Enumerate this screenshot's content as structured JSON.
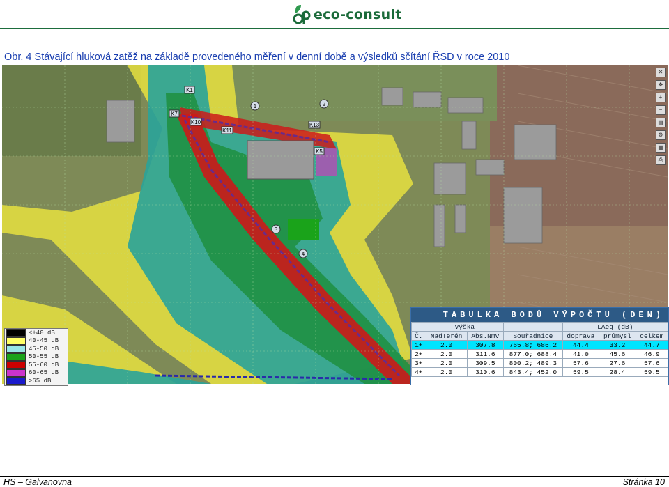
{
  "header": {
    "logo_text": "eco-consult"
  },
  "caption": "Obr. 4 Stávající hluková zatěž na základě provedeného měření v denní době a výsledků sčítání ŘSD v roce 2010",
  "map": {
    "labels": [
      "1",
      "2",
      "3",
      "4",
      "K1",
      "K5",
      "K10",
      "K11",
      "K13",
      "K7"
    ],
    "legend": [
      {
        "label": "<+40 dB",
        "color": "#000000"
      },
      {
        "label": "40-45 dB",
        "color": "#ffff66"
      },
      {
        "label": "45-50 dB",
        "color": "#99e6e6"
      },
      {
        "label": "50-55 dB",
        "color": "#1aa31a"
      },
      {
        "label": "55-60 dB",
        "color": "#cc0000"
      },
      {
        "label": "60-65 dB",
        "color": "#cc33cc"
      },
      {
        "label": ">65 dB",
        "color": "#1a1acc"
      }
    ]
  },
  "table": {
    "title": "TABULKA BODŮ VÝPOČTU (DEN)",
    "group_headers": {
      "vyska": "Výška",
      "laeq": "LAeq (dB)"
    },
    "columns": [
      "Č.",
      "NadTerén",
      "Abs.Nmv",
      "Souřadnice",
      "doprava",
      "průmysl",
      "celkem"
    ],
    "rows": [
      {
        "c": "1+",
        "nad": "2.0",
        "abs": "307.8",
        "sour": "765.8; 686.2",
        "dop": "44.4",
        "pru": "33.2",
        "cel": "44.7"
      },
      {
        "c": "2+",
        "nad": "2.0",
        "abs": "311.6",
        "sour": "877.0; 688.4",
        "dop": "41.0",
        "pru": "45.6",
        "cel": "46.9"
      },
      {
        "c": "3+",
        "nad": "2.0",
        "abs": "309.5",
        "sour": "800.2; 489.3",
        "dop": "57.6",
        "pru": "27.6",
        "cel": "57.6"
      },
      {
        "c": "4+",
        "nad": "2.0",
        "abs": "310.6",
        "sour": "843.4; 452.0",
        "dop": "59.5",
        "pru": "28.4",
        "cel": "59.5"
      }
    ]
  },
  "footer": {
    "left": "HS – Galvanovna",
    "right": "Stránka 10"
  }
}
